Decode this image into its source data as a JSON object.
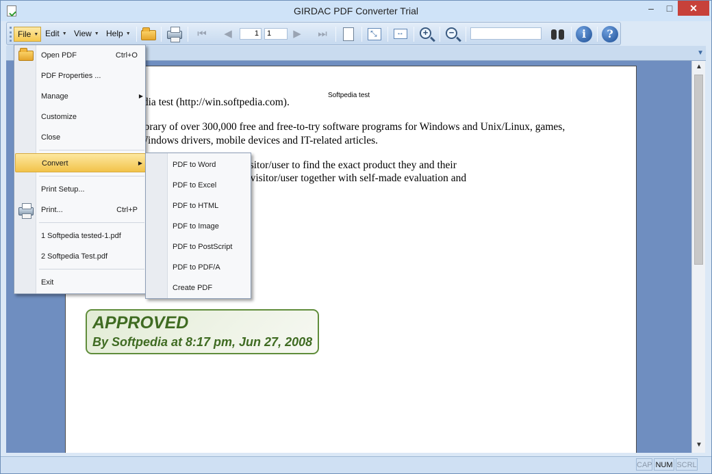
{
  "window": {
    "title": "GIRDAC PDF Converter Trial",
    "min_glyph": "▭",
    "max_glyph": "□",
    "close_glyph": "✕"
  },
  "toolbar": {
    "menus": {
      "file": "File",
      "edit": "Edit",
      "view": "View",
      "help": "Help"
    },
    "page_current": "1",
    "page_total": "1",
    "search_value": "",
    "nav_first": "⏮",
    "nav_prev": "◀",
    "nav_next": "▶",
    "nav_last": "⏭",
    "info_glyph": "i",
    "help_glyph": "?",
    "icons": [
      "open-folder",
      "print",
      "first-page",
      "previous-page",
      "next-page",
      "last-page",
      "single-page",
      "fit-page",
      "fit-width",
      "zoom-in",
      "zoom-out",
      "find",
      "about",
      "help"
    ]
  },
  "document": {
    "header": "Softpedia test",
    "lines": [
      "edia test (http://win.softpedia.com).",
      "library of over 300,000 free and free-to-try software programs for Windows and Unix/Linux, games,",
      "Windows drivers, mobile devices and IT-related articles.",
      "cts in order to allow the visitor/user to find the exact product they and their",
      "ly the best products to the visitor/user together with self-made evaluation and"
    ],
    "stamp_title": "APPROVED",
    "stamp_sub": "By Softpedia at 8:17 pm, Jun 27, 2008"
  },
  "file_menu": {
    "open_pdf": "Open PDF",
    "open_pdf_sc": "Ctrl+O",
    "properties": "PDF Properties ...",
    "manage": "Manage",
    "customize": "Customize",
    "close": "Close",
    "convert": "Convert",
    "print_setup": "Print Setup...",
    "print": "Print...",
    "print_sc": "Ctrl+P",
    "recent_1": "1 Softpedia tested-1.pdf",
    "recent_2": "2 Softpedia Test.pdf",
    "exit": "Exit"
  },
  "convert_menu": [
    "PDF to Word",
    "PDF to Excel",
    "PDF to HTML",
    "PDF to Image",
    "PDF to PostScript",
    "PDF to PDF/A",
    "Create PDF"
  ],
  "statusbar": {
    "cap": "CAP",
    "num": "NUM",
    "scrl": "SCRL"
  },
  "colors": {
    "viewport_bg": "#6f8ec0",
    "menu_highlight": "#f7c94f",
    "stamp_green": "#3f6b22"
  }
}
